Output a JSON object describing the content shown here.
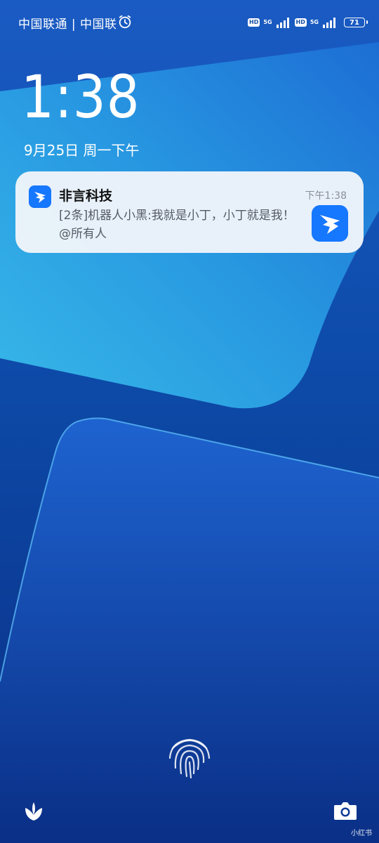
{
  "status_bar": {
    "carriers": "中国联通 | 中国联",
    "alarm_icon": "alarm-clock-icon",
    "sim1": {
      "hd": "HD",
      "network": "5G"
    },
    "sim2": {
      "hd": "HD",
      "network": "5G"
    },
    "battery_level": "71"
  },
  "lockscreen": {
    "time": "1:38",
    "date": "9月25日 周一下午"
  },
  "notification": {
    "app_name": "非言科技",
    "time": "下午1:38",
    "body": "[2条]机器人小黑:我就是小丁，小丁就是我！@所有人",
    "app_icon": "dingtalk-icon",
    "accent": "#1677ff"
  },
  "bottom": {
    "left_icon": "flower-icon",
    "right_icon": "camera-icon",
    "fingerprint_icon": "fingerprint-icon"
  },
  "watermark": "小红书"
}
